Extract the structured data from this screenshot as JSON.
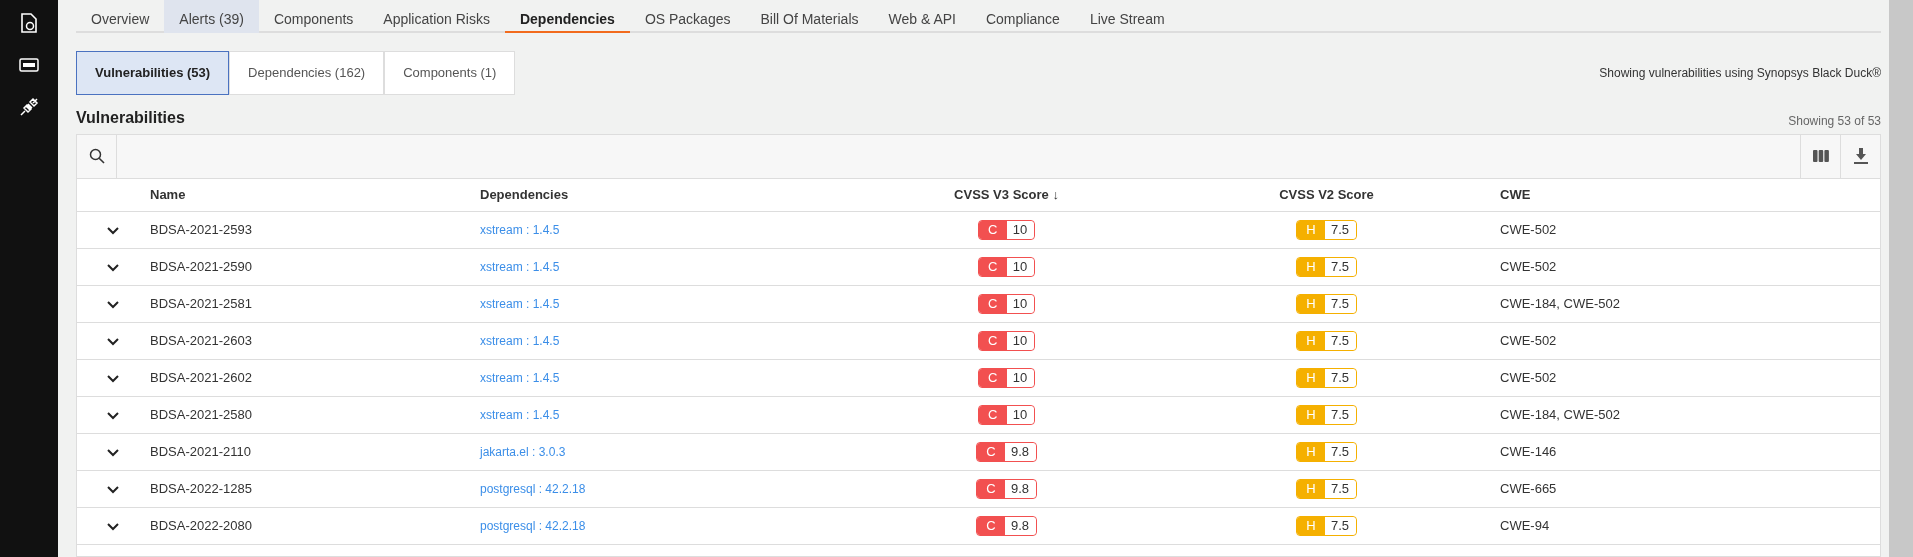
{
  "sidebar": {
    "items": [
      {
        "kind": "document",
        "selected": false
      },
      {
        "kind": "api",
        "selected": false
      },
      {
        "kind": "plug",
        "selected": false
      }
    ]
  },
  "tabs": [
    {
      "label": "Overview",
      "selected": false,
      "highlighted": false
    },
    {
      "label": "Alerts (39)",
      "selected": false,
      "highlighted": true
    },
    {
      "label": "Components",
      "selected": false,
      "highlighted": false
    },
    {
      "label": "Application Risks",
      "selected": false,
      "highlighted": false
    },
    {
      "label": "Dependencies",
      "selected": true,
      "highlighted": false
    },
    {
      "label": "OS Packages",
      "selected": false,
      "highlighted": false
    },
    {
      "label": "Bill Of Materials",
      "selected": false,
      "highlighted": false
    },
    {
      "label": "Web & API",
      "selected": false,
      "highlighted": false
    },
    {
      "label": "Compliance",
      "selected": false,
      "highlighted": false
    },
    {
      "label": "Live Stream",
      "selected": false,
      "highlighted": false
    }
  ],
  "subtabs": [
    {
      "label": "Vulnerabilities (53)",
      "selected": true
    },
    {
      "label": "Dependencies (162)",
      "selected": false
    },
    {
      "label": "Components (1)",
      "selected": false
    }
  ],
  "source_note": "Showing vulnerabilities using Synopsys Black Duck®",
  "section_title": "Vulnerabilities",
  "count_text": "Showing 53 of 53",
  "table": {
    "columns": [
      "Name",
      "Dependencies",
      "CVSS V3 Score ↓",
      "CVSS V2 Score",
      "CWE"
    ],
    "rows": [
      {
        "name": "BDSA-2021-2593",
        "dependency": "xstream : 1.4.5",
        "v3": {
          "kind": "critical",
          "letter": "C",
          "score": "10"
        },
        "v2": {
          "kind": "high",
          "letter": "H",
          "score": "7.5"
        },
        "cwe": "CWE-502"
      },
      {
        "name": "BDSA-2021-2590",
        "dependency": "xstream : 1.4.5",
        "v3": {
          "kind": "critical",
          "letter": "C",
          "score": "10"
        },
        "v2": {
          "kind": "high",
          "letter": "H",
          "score": "7.5"
        },
        "cwe": "CWE-502"
      },
      {
        "name": "BDSA-2021-2581",
        "dependency": "xstream : 1.4.5",
        "v3": {
          "kind": "critical",
          "letter": "C",
          "score": "10"
        },
        "v2": {
          "kind": "high",
          "letter": "H",
          "score": "7.5"
        },
        "cwe": "CWE-184, CWE-502"
      },
      {
        "name": "BDSA-2021-2603",
        "dependency": "xstream : 1.4.5",
        "v3": {
          "kind": "critical",
          "letter": "C",
          "score": "10"
        },
        "v2": {
          "kind": "high",
          "letter": "H",
          "score": "7.5"
        },
        "cwe": "CWE-502"
      },
      {
        "name": "BDSA-2021-2602",
        "dependency": "xstream : 1.4.5",
        "v3": {
          "kind": "critical",
          "letter": "C",
          "score": "10"
        },
        "v2": {
          "kind": "high",
          "letter": "H",
          "score": "7.5"
        },
        "cwe": "CWE-502"
      },
      {
        "name": "BDSA-2021-2580",
        "dependency": "xstream : 1.4.5",
        "v3": {
          "kind": "critical",
          "letter": "C",
          "score": "10"
        },
        "v2": {
          "kind": "high",
          "letter": "H",
          "score": "7.5"
        },
        "cwe": "CWE-184, CWE-502"
      },
      {
        "name": "BDSA-2021-2110",
        "dependency": "jakarta.el : 3.0.3",
        "v3": {
          "kind": "critical",
          "letter": "C",
          "score": "9.8"
        },
        "v2": {
          "kind": "high",
          "letter": "H",
          "score": "7.5"
        },
        "cwe": "CWE-146"
      },
      {
        "name": "BDSA-2022-1285",
        "dependency": "postgresql : 42.2.18",
        "v3": {
          "kind": "critical",
          "letter": "C",
          "score": "9.8"
        },
        "v2": {
          "kind": "high",
          "letter": "H",
          "score": "7.5"
        },
        "cwe": "CWE-665"
      },
      {
        "name": "BDSA-2022-2080",
        "dependency": "postgresql : 42.2.18",
        "v3": {
          "kind": "critical",
          "letter": "C",
          "score": "9.8"
        },
        "v2": {
          "kind": "high",
          "letter": "H",
          "score": "7.5"
        },
        "cwe": "CWE-94"
      }
    ]
  }
}
